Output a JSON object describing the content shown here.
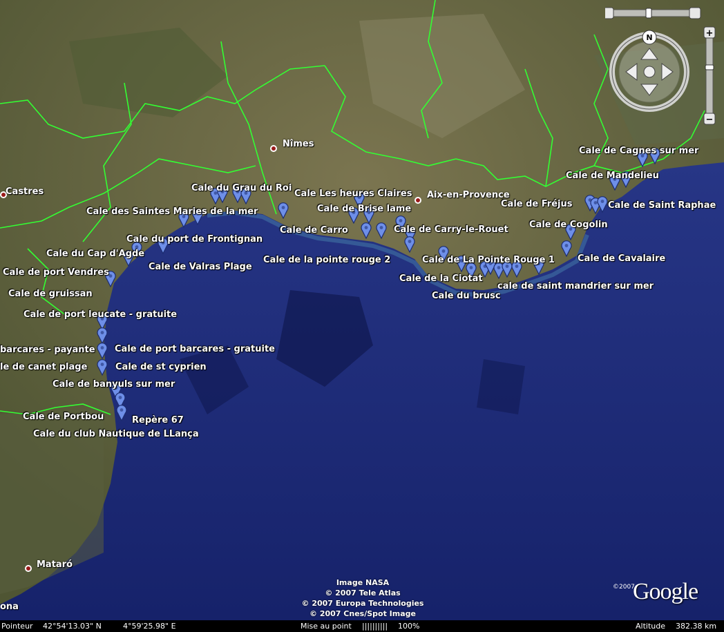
{
  "cities": [
    {
      "key": "nimes",
      "name": "Nîmes"
    },
    {
      "key": "castres",
      "name": "Castres"
    },
    {
      "key": "aix",
      "name": "Aix-en-Provence"
    },
    {
      "key": "mataro",
      "name": "Mataró"
    },
    {
      "key": "barcelona",
      "name": "ona"
    }
  ],
  "placemarks": [
    "Cale du Grau du Roi",
    "Cale Les heures Claires",
    "Cale des Saintes Maries de la mer",
    "Cale de Brise lame",
    "Cale de Carro",
    "Cale de Carry-le-Rouet",
    "Cale du port de Frontignan",
    "Cale du Cap d'Agde",
    "Cale de Valras Plage",
    "Cale de la pointe rouge 2",
    "Cale de port Vendres",
    "Cale de gruissan",
    "Cale de port leucate - gratuite",
    "barcares - payante",
    "Cale de port barcares - gratuite",
    "le de canet plage",
    "Cale de st cyprien",
    "Cale de banyuls sur mer",
    "Cale de Portbou",
    "Repère 67",
    "Cale du club Nautique de LLança",
    "Cale de La Pointe Rouge 1",
    "Cale de la Ciotat",
    "Cale du brusc",
    "cale de saint mandrier sur mer",
    "Cale de Cavalaire",
    "Cale de Cogolin",
    "Cale de Fréjus",
    "Cale de Saint Raphae",
    "Cale de Mandelieu",
    "Cale de Cagnes sur mer"
  ],
  "credits": [
    "Image NASA",
    "© 2007 Tele Atlas",
    "© 2007 Europa Technologies",
    "© 2007 Cnes/Spot Image"
  ],
  "logo": {
    "text": "Google",
    "year": "©2007"
  },
  "status": {
    "pointer_label": "Pointeur",
    "lat": "42°54'13.03\" N",
    "lon": "4°59'25.98\" E",
    "streaming_label": "Mise au point",
    "streaming_bar": "||||||||||",
    "streaming_pct": "100%",
    "altitude_label": "Altitude",
    "altitude_value": "382.38 km"
  },
  "nav": {
    "north": "N",
    "zoom_in": "+",
    "zoom_out": "−"
  },
  "colors": {
    "sea": "#1e2d78",
    "land": "#6b6a45",
    "borders": "#33ff33",
    "pin": "#6e8fe8",
    "status_bar": "#000000"
  }
}
